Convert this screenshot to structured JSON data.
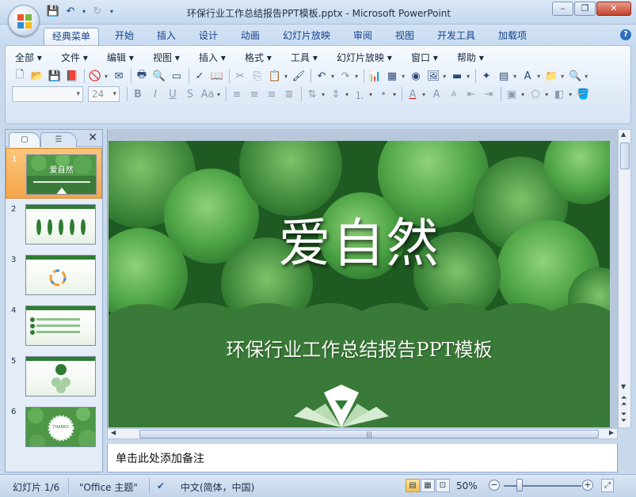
{
  "window": {
    "title": "环保行业工作总结报告PPT模板.pptx - Microsoft PowerPoint",
    "controls": [
      "–",
      "❐",
      "✕"
    ]
  },
  "ribbon_tabs": [
    "经典菜单",
    "开始",
    "插入",
    "设计",
    "动画",
    "幻灯片放映",
    "审阅",
    "视图",
    "开发工具",
    "加载项"
  ],
  "classic_menu": [
    "全部 ▾",
    "文件 ▾",
    "编辑 ▾",
    "视图 ▾",
    "插入 ▾",
    "格式 ▾",
    "工具 ▾",
    "幻灯片放映 ▾",
    "窗口 ▾",
    "帮助 ▾"
  ],
  "toolbar": {
    "font_name": "",
    "font_size": "24"
  },
  "left_pane": {
    "slides": [
      {
        "num": "1",
        "title": "爱自然"
      },
      {
        "num": "2"
      },
      {
        "num": "3"
      },
      {
        "num": "4"
      },
      {
        "num": "5"
      },
      {
        "num": "6",
        "title": "THANKS"
      }
    ]
  },
  "slide": {
    "title": "爱自然",
    "subtitle": "环保行业工作总结报告PPT模板"
  },
  "notes": {
    "placeholder": "单击此处添加备注"
  },
  "status": {
    "slide_info": "幻灯片 1/6",
    "theme": "\"Office 主题\"",
    "language": "中文(简体，中国)",
    "zoom": "50%",
    "zoom_fraction": 0.5
  },
  "colors": {
    "slide_green": "#3f7e3f",
    "selection_orange": "#f5a64c"
  }
}
